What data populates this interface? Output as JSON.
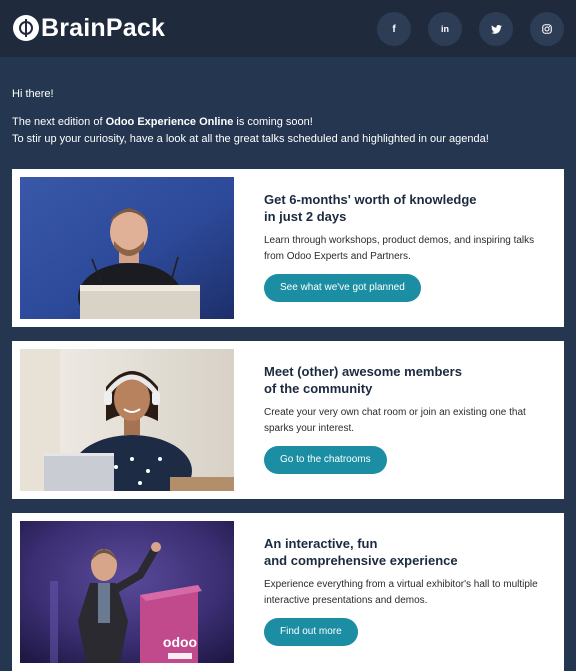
{
  "header": {
    "brand": "BrainPack",
    "social": [
      {
        "name": "facebook-icon",
        "glyph": "f"
      },
      {
        "name": "linkedin-icon",
        "glyph": "in"
      },
      {
        "name": "twitter-icon",
        "glyph": ""
      },
      {
        "name": "instagram-icon",
        "glyph": ""
      }
    ]
  },
  "intro": {
    "greeting": "Hi there!",
    "line1_pre": "The next edition of ",
    "line1_bold": "Odoo Experience Online",
    "line1_post": " is coming soon!",
    "line2": "To stir up your curiosity, have a look at all the great talks scheduled and highlighted in our agenda!"
  },
  "cards": [
    {
      "title_line1": "Get 6-months' worth of knowledge",
      "title_line2": "in just 2 days",
      "description": "Learn through workshops, product demos, and inspiring talks from Odoo Experts and Partners.",
      "button": "See what we've got planned"
    },
    {
      "title_line1": "Meet (other) awesome members",
      "title_line2": "of the community",
      "description": "Create your very own chat room or join an existing one that sparks your interest.",
      "button": "Go to the chatrooms"
    },
    {
      "title_line1": "An interactive, fun",
      "title_line2": "and comprehensive experience",
      "description": "Experience everything from a virtual exhibitor's hall to multiple interactive presentations and demos.",
      "button": "Find out more"
    }
  ],
  "colors": {
    "background": "#253650",
    "header": "#1f2a3c",
    "button": "#1c8ea4",
    "title": "#1c2a3f"
  }
}
